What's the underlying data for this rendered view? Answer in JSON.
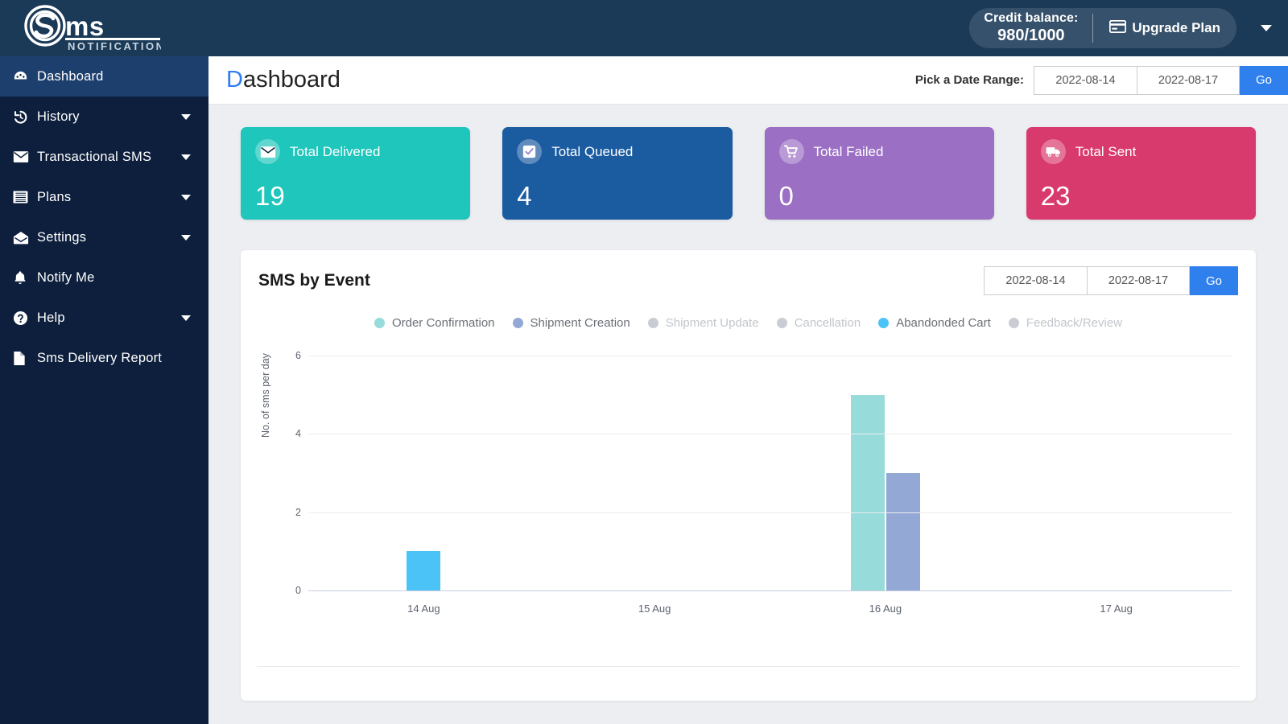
{
  "topbar": {
    "brand_name": "Sms",
    "brand_sub": "NOTIFICATION",
    "credit_label": "Credit balance:",
    "credit_value": "980/1000",
    "upgrade_label": "Upgrade Plan"
  },
  "sidebar": {
    "items": [
      {
        "label": "Dashboard",
        "icon": "dashboard-icon",
        "active": true,
        "caret": false
      },
      {
        "label": "History",
        "icon": "history-icon",
        "active": false,
        "caret": true
      },
      {
        "label": "Transactional SMS",
        "icon": "envelope-icon",
        "active": false,
        "caret": true
      },
      {
        "label": "Plans",
        "icon": "list-icon",
        "active": false,
        "caret": true
      },
      {
        "label": "Settings",
        "icon": "open-envelope-icon",
        "active": false,
        "caret": true
      },
      {
        "label": "Notify Me",
        "icon": "bell-icon",
        "active": false,
        "caret": false
      },
      {
        "label": "Help",
        "icon": "question-circle-icon",
        "active": false,
        "caret": true
      },
      {
        "label": "Sms Delivery Report",
        "icon": "file-icon",
        "active": false,
        "caret": false
      }
    ]
  },
  "page": {
    "title_first": "D",
    "title_rest": "ashboard",
    "daterange_label": "Pick a Date Range:",
    "date_from": "2022-08-14",
    "date_to": "2022-08-17",
    "go_label": "Go"
  },
  "stats": [
    {
      "title": "Total Delivered",
      "value": "19",
      "color": "#1ec6bc",
      "icon": "envelope-icon"
    },
    {
      "title": "Total Queued",
      "value": "4",
      "color": "#1b5ba0",
      "icon": "check-square-icon"
    },
    {
      "title": "Total Failed",
      "value": "0",
      "color": "#9b6fc4",
      "icon": "cart-icon"
    },
    {
      "title": "Total Sent",
      "value": "23",
      "color": "#d93a6e",
      "icon": "truck-icon"
    }
  ],
  "panel": {
    "title": "SMS by Event",
    "date_from": "2022-08-14",
    "date_to": "2022-08-17",
    "go_label": "Go"
  },
  "chart_data": {
    "type": "bar",
    "title": "SMS by Event",
    "xlabel": "",
    "ylabel": "No. of sms per day",
    "categories": [
      "14 Aug",
      "15 Aug",
      "16 Aug",
      "17 Aug"
    ],
    "ylim": [
      0,
      6
    ],
    "yticks": [
      0,
      2,
      4,
      6
    ],
    "grid": true,
    "legend_position": "top-center",
    "series": [
      {
        "name": "Order Confirmation",
        "color": "#97dcdb",
        "enabled": true,
        "values": [
          0,
          0,
          5,
          0
        ]
      },
      {
        "name": "Shipment Creation",
        "color": "#93a8d4",
        "enabled": true,
        "values": [
          0,
          0,
          3,
          0
        ]
      },
      {
        "name": "Shipment Update",
        "color": "#c9cdd3",
        "enabled": false,
        "values": [
          0,
          0,
          0,
          0
        ]
      },
      {
        "name": "Cancellation",
        "color": "#c9cdd3",
        "enabled": false,
        "values": [
          0,
          0,
          0,
          0
        ]
      },
      {
        "name": "Abandonded Cart",
        "color": "#4bc3f7",
        "enabled": true,
        "values": [
          1,
          0,
          0,
          0
        ]
      },
      {
        "name": "Feedback/Review",
        "color": "#c9cdd3",
        "enabled": false,
        "values": [
          0,
          0,
          0,
          0
        ]
      }
    ]
  }
}
